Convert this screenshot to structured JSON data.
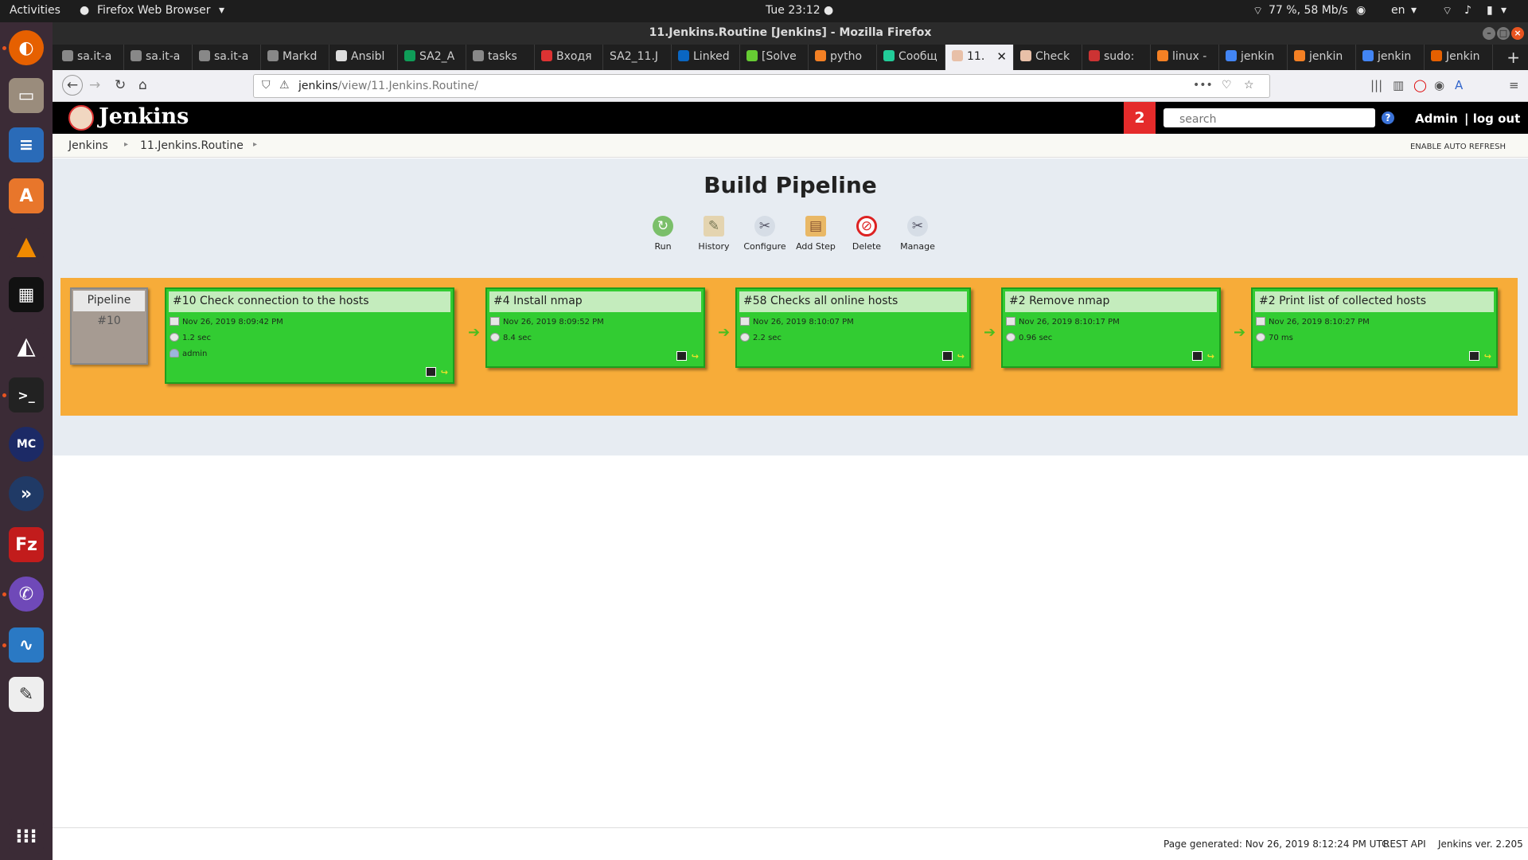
{
  "topbar": {
    "activities": "Activities",
    "app_name": "Firefox Web Browser",
    "clock": "Tue 23:12",
    "network": "77 %, 58 Mb/s",
    "lang": "en"
  },
  "window": {
    "title": "11.Jenkins.Routine [Jenkins] - Mozilla Firefox"
  },
  "tabs": [
    {
      "label": "sa.it-a"
    },
    {
      "label": "sa.it-a"
    },
    {
      "label": "sa.it-a"
    },
    {
      "label": "Markd"
    },
    {
      "label": "Ansibl"
    },
    {
      "label": "SA2_A"
    },
    {
      "label": "tasks"
    },
    {
      "label": "Входя"
    },
    {
      "label": "SA2_11.J"
    },
    {
      "label": "Linked"
    },
    {
      "label": "[Solve"
    },
    {
      "label": "pytho"
    },
    {
      "label": "Сообщ"
    },
    {
      "label": "11."
    },
    {
      "label": "Check"
    },
    {
      "label": "sudo:"
    },
    {
      "label": "linux -"
    },
    {
      "label": "jenkin"
    },
    {
      "label": "jenkin"
    },
    {
      "label": "jenkin"
    },
    {
      "label": "Jenkin"
    }
  ],
  "url": {
    "host": "jenkins",
    "path": "/view/11.Jenkins.Routine/"
  },
  "jenkins": {
    "title": "Jenkins",
    "notifications": "2",
    "search_placeholder": "search",
    "user": "Admin",
    "logout": "| log out",
    "breadcrumb": [
      "Jenkins",
      "11.Jenkins.Routine"
    ],
    "auto_refresh": "ENABLE AUTO REFRESH"
  },
  "view": {
    "title": "Build Pipeline",
    "toolbar": {
      "run": "Run",
      "history": "History",
      "configure": "Configure",
      "add_step": "Add Step",
      "delete": "Delete",
      "manage": "Manage"
    },
    "pipeline": {
      "label": "Pipeline",
      "number": "#10"
    },
    "stages": [
      {
        "name": "#10 Check connection to the hosts",
        "date": "Nov 26, 2019 8:09:42 PM",
        "duration": "1.2 sec",
        "user": "admin",
        "status_color": "#32cc32"
      },
      {
        "name": "#4 Install nmap",
        "date": "Nov 26, 2019 8:09:52 PM",
        "duration": "8.4 sec",
        "status_color": "#32cc32"
      },
      {
        "name": "#58 Checks all online hosts",
        "date": "Nov 26, 2019 8:10:07 PM",
        "duration": "2.2 sec",
        "status_color": "#32cc32"
      },
      {
        "name": "#2 Remove nmap",
        "date": "Nov 26, 2019 8:10:17 PM",
        "duration": "0.96 sec",
        "status_color": "#32cc32"
      },
      {
        "name": "#2 Print list of collected hosts",
        "date": "Nov 26, 2019 8:10:27 PM",
        "duration": "70 ms",
        "status_color": "#32cc32"
      }
    ]
  },
  "footer": {
    "generated": "Page generated: Nov 26, 2019 8:12:24 PM UTC",
    "rest_api": "REST API",
    "version": "Jenkins ver. 2.205"
  }
}
